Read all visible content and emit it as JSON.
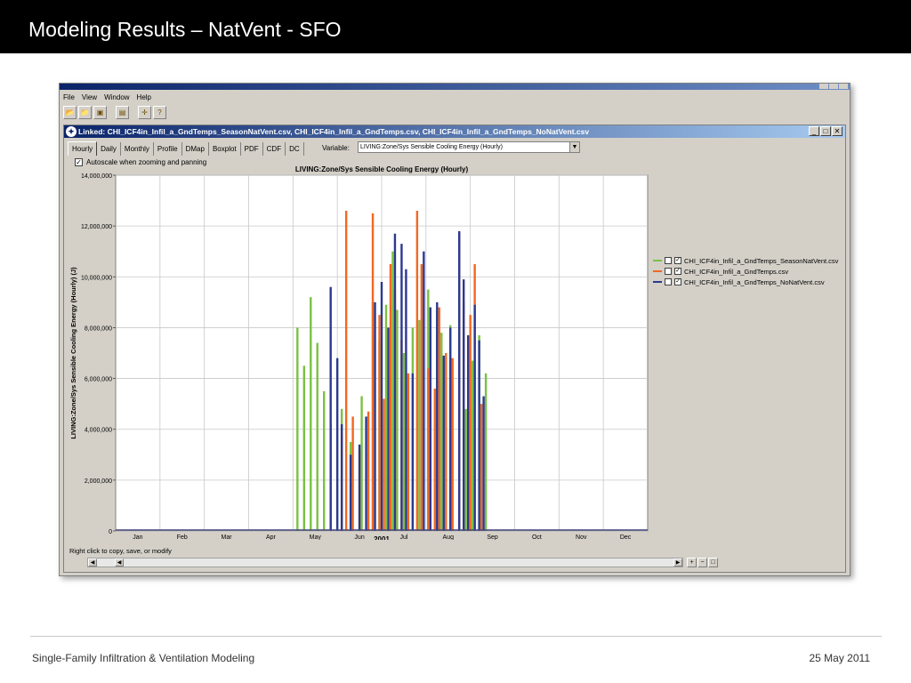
{
  "slide": {
    "title": "Modeling Results – NatVent - SFO",
    "footer_left": "Single-Family Infiltration & Ventilation Modeling",
    "footer_right": "25 May 2011"
  },
  "app": {
    "menu": [
      "File",
      "View",
      "Window",
      "Help"
    ],
    "toolbar_icons": [
      "open-folder-icon",
      "open-file-icon",
      "save-icon",
      "export-icon",
      "move-icon",
      "help-icon"
    ],
    "inner_window_title": "Linked: CHI_ICF4in_Infil_a_GndTemps_SeasonNatVent.csv, CHI_ICF4in_Infil_a_GndTemps.csv, CHI_ICF4in_Infil_a_GndTemps_NoNatVent.csv",
    "tabs": [
      "Hourly",
      "Daily",
      "Monthly",
      "Profile",
      "DMap",
      "Boxplot",
      "PDF",
      "CDF",
      "DC"
    ],
    "active_tab": "Hourly",
    "variable_label": "Variable:",
    "variable_value": "LIVING:Zone/Sys Sensible Cooling Energy (Hourly)",
    "autoscale_label": "Autoscale when zooming and panning",
    "autoscale_checked": "✓",
    "status_text": "Right click to copy, save, or modify"
  },
  "chart_data": {
    "type": "bar",
    "title": "LIVING:Zone/Sys Sensible Cooling Energy (Hourly)",
    "xlabel": "2001",
    "ylabel": "LIVING:Zone/Sys Sensible Cooling Energy (Hourly) (J)",
    "ylim": [
      0,
      14000000
    ],
    "yticks": [
      "0",
      "2,000,000",
      "4,000,000",
      "6,000,000",
      "8,000,000",
      "10,000,000",
      "12,000,000",
      "14,000,000"
    ],
    "ytick_values": [
      0,
      2000000,
      4000000,
      6000000,
      8000000,
      10000000,
      12000000,
      14000000
    ],
    "months": [
      "Jan",
      "Feb",
      "Mar",
      "Apr",
      "May",
      "Jun",
      "Jul",
      "Aug",
      "Sep",
      "Oct",
      "Nov",
      "Dec"
    ],
    "grid": true,
    "legend_position": "right",
    "series": [
      {
        "name": "CHI_ICF4in_Infil_a_GndTemps_SeasonNatVent.csv",
        "color": "#7ac143",
        "peaks": [
          [
            4.1,
            8000000
          ],
          [
            4.25,
            6500000
          ],
          [
            4.4,
            9200000
          ],
          [
            4.55,
            7400000
          ],
          [
            4.7,
            5500000
          ],
          [
            4.85,
            4200000
          ],
          [
            5.1,
            4800000
          ],
          [
            5.3,
            3500000
          ],
          [
            5.55,
            5300000
          ],
          [
            5.8,
            9000000
          ],
          [
            5.95,
            7500000
          ],
          [
            6.1,
            8900000
          ],
          [
            6.25,
            11000000
          ],
          [
            6.35,
            8700000
          ],
          [
            6.5,
            7000000
          ],
          [
            6.7,
            8000000
          ],
          [
            6.85,
            8300000
          ],
          [
            7.05,
            9500000
          ],
          [
            7.25,
            8700000
          ],
          [
            7.35,
            7800000
          ],
          [
            7.55,
            8100000
          ],
          [
            7.75,
            6400000
          ],
          [
            7.9,
            4800000
          ],
          [
            8.05,
            6700000
          ],
          [
            8.2,
            7700000
          ],
          [
            8.35,
            6200000
          ]
        ]
      },
      {
        "name": "CHI_ICF4in_Infil_a_GndTemps.csv",
        "color": "#f26722",
        "peaks": [
          [
            5.1,
            3800000
          ],
          [
            5.2,
            12600000
          ],
          [
            5.35,
            4500000
          ],
          [
            5.5,
            3200000
          ],
          [
            5.7,
            4700000
          ],
          [
            5.8,
            12500000
          ],
          [
            5.95,
            8500000
          ],
          [
            6.05,
            5200000
          ],
          [
            6.2,
            10500000
          ],
          [
            6.3,
            9500000
          ],
          [
            6.45,
            7500000
          ],
          [
            6.6,
            6200000
          ],
          [
            6.8,
            12600000
          ],
          [
            6.9,
            10500000
          ],
          [
            7.05,
            6400000
          ],
          [
            7.2,
            5600000
          ],
          [
            7.3,
            8800000
          ],
          [
            7.45,
            7000000
          ],
          [
            7.6,
            6800000
          ],
          [
            7.75,
            11700000
          ],
          [
            7.85,
            9000000
          ],
          [
            8.0,
            8500000
          ],
          [
            8.1,
            10500000
          ],
          [
            8.25,
            5000000
          ]
        ]
      },
      {
        "name": "CHI_ICF4in_Infil_a_GndTemps_NoNatVent.csv",
        "color": "#2b3990",
        "peaks": [
          [
            4.85,
            9600000
          ],
          [
            5.0,
            6800000
          ],
          [
            5.1,
            4200000
          ],
          [
            5.3,
            3000000
          ],
          [
            5.5,
            3400000
          ],
          [
            5.65,
            4500000
          ],
          [
            5.85,
            9000000
          ],
          [
            6.0,
            9800000
          ],
          [
            6.15,
            8000000
          ],
          [
            6.3,
            11700000
          ],
          [
            6.45,
            11300000
          ],
          [
            6.55,
            10300000
          ],
          [
            6.7,
            6200000
          ],
          [
            6.95,
            11000000
          ],
          [
            7.1,
            8800000
          ],
          [
            7.25,
            9000000
          ],
          [
            7.4,
            6900000
          ],
          [
            7.55,
            8000000
          ],
          [
            7.75,
            11800000
          ],
          [
            7.85,
            9900000
          ],
          [
            7.95,
            7700000
          ],
          [
            8.1,
            8900000
          ],
          [
            8.2,
            7500000
          ],
          [
            8.3,
            5300000
          ]
        ]
      }
    ]
  }
}
